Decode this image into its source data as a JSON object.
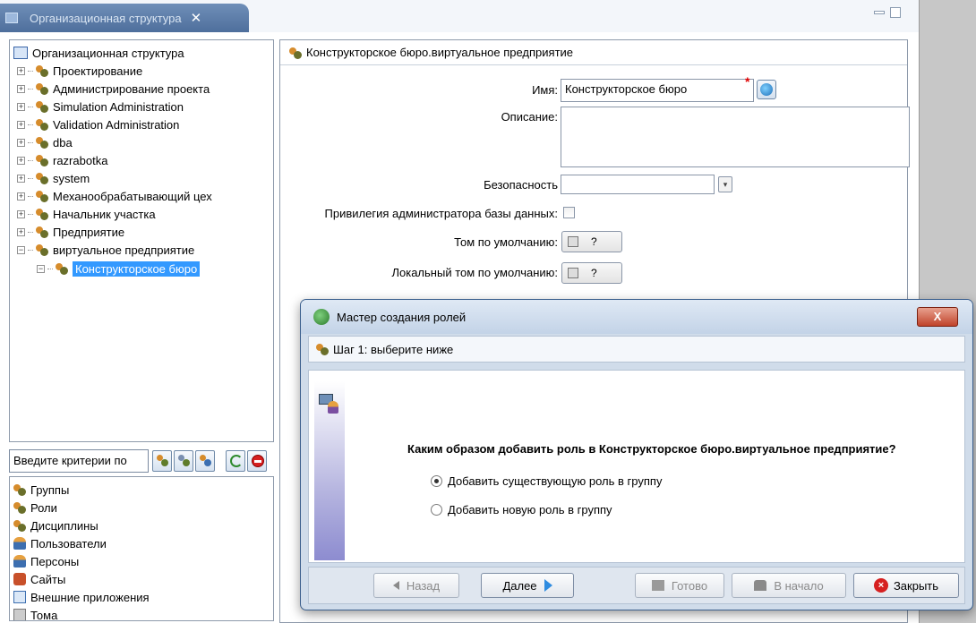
{
  "tab": {
    "title": "Организационная структура",
    "close": "✕"
  },
  "tree": {
    "root": "Организационная структура",
    "items": [
      "Проектирование",
      "Администрирование проекта",
      "Simulation Administration",
      "Validation Administration",
      "dba",
      "razrabotka",
      "system",
      "Механообрабатывающий цех",
      "Начальник участка",
      "Предприятие",
      "виртуальное предприятие"
    ],
    "child_selected": "Конструкторское бюро"
  },
  "search": {
    "placeholder": "Введите критерии по"
  },
  "types_list": [
    "Группы",
    "Роли",
    "Дисциплины",
    "Пользователи",
    "Персоны",
    "Сайты",
    "Внешние приложения",
    "Тома"
  ],
  "form": {
    "header": "Конструкторское бюро.виртуальное предприятие",
    "name_label": "Имя:",
    "name_value": "Конструкторское бюро",
    "description_label": "Описание:",
    "security_label": "Безопасность",
    "dba_privilege_label": "Привилегия администратора базы данных:",
    "default_volume_label": "Том по умолчанию:",
    "local_volume_label": "Локальный том по умолчанию:",
    "volume_value": "?"
  },
  "dialog": {
    "title": "Мастер создания ролей",
    "close": "X",
    "step": "Шаг 1: выберите ниже",
    "question": "Каким образом добавить роль в Конструкторское бюро.виртуальное предприятие?",
    "option_existing": "Добавить существующую роль в группу",
    "option_new": "Добавить новую роль в группу",
    "selected_option": "existing",
    "buttons": {
      "back": "Назад",
      "next": "Далее",
      "finish": "Готово",
      "start": "В начало",
      "close": "Закрыть"
    }
  },
  "colors": {
    "tab_bg": "#5a7aa6",
    "selection": "#3399ff",
    "dialog_close": "#c0432a",
    "required": "#e00000"
  }
}
